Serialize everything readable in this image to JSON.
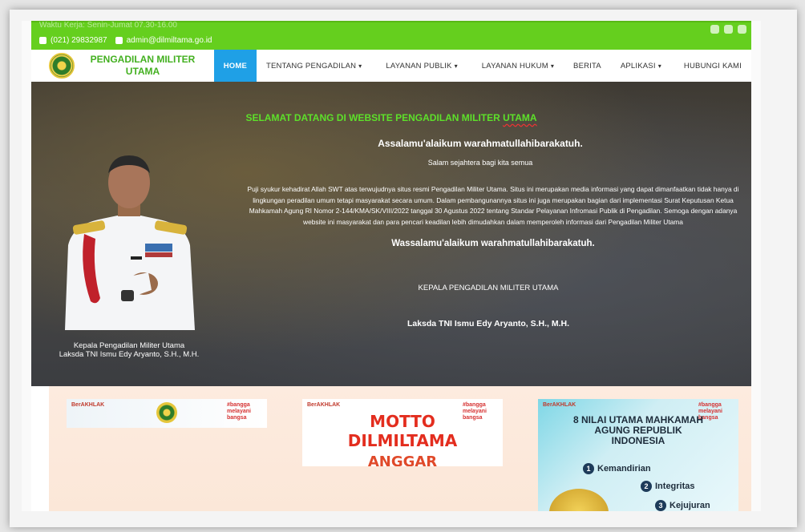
{
  "topbar": {
    "line1": "Waktu Kerja: Senin-Jumat 07.30-16.00",
    "phone": "(021) 29832987",
    "email": "admin@dilmiltama.go.id"
  },
  "logo": {
    "title": "PENGADILAN MILITER UTAMA"
  },
  "menu": [
    {
      "label": "HOME",
      "caret": ""
    },
    {
      "label": "TENTANG PENGADILAN",
      "caret": "▾"
    },
    {
      "label": "LAYANAN PUBLIK",
      "caret": "▾"
    },
    {
      "label": "LAYANAN HUKUM",
      "caret": "▾"
    },
    {
      "label": "BERITA",
      "caret": ""
    },
    {
      "label": "APLIKASI",
      "caret": "▾"
    },
    {
      "label": "HUBUNGI KAMI",
      "caret": ""
    }
  ],
  "hero": {
    "title_a": "SELAMAT DATANG DI WEBSITE PENGADILAN MILITER ",
    "title_b": "UTAMA",
    "greeting": "Assalamu'alaikum warahmatullahibarakatuh.",
    "greeting2": "Salam sejahtera bagi kita semua",
    "body": "Puji syukur kehadirat Allah SWT atas terwujudnya situs resmi Pengadilan Militer Utama. Situs ini merupakan media informasi yang dapat dimanfaatkan tidak hanya di lingkungan peradilan umum tetapi masyarakat secara umum. Dalam pembangunannya situs ini juga merupakan bagian dari implementasi Surat Keputusan Ketua Mahkamah Agung RI Nomor 2-144/KMA/SK/VIII/2022 tanggal 30 Agustus 2022 tentang Standar Pelayanan Infromasi Publik di Pengadilan. Semoga dengan adanya website ini masyarakat dan para pencari keadilan lebih dimudahkan dalam memperoleh informasi dari Pengadilan Militer Utama",
    "closing": "Wassalamu'alaikum warahmatullahibarakatuh.",
    "position": "KEPALA PENGADILAN MILITER UTAMA",
    "name": "Laksda TNI Ismu Edy Aryanto, S.H., M.H.",
    "caption_line1": "Kepala Pengadilan Militer Utama",
    "caption_line2": "Laksda TNI Ismu Edy Aryanto, S.H., M.H."
  },
  "cards": {
    "badge": "BerAKHLAK",
    "badge_right": "#bangga melayani bangsa",
    "motto_line1": "MOTTO",
    "motto_line2": "DILMILTAMA",
    "motto_line3": "ANGGAR",
    "nilai_title": "8 NILAI UTAMA MAHKAMAH AGUNG REPUBLIK INDONESIA",
    "nilai": [
      {
        "num": "1",
        "label": "Kemandirian"
      },
      {
        "num": "2",
        "label": "Integritas"
      },
      {
        "num": "3",
        "label": "Kejujuran"
      }
    ]
  },
  "colors": {
    "brand_green": "#65cf1e",
    "active_blue": "#1fa0e6",
    "title_green": "#5de02a"
  }
}
